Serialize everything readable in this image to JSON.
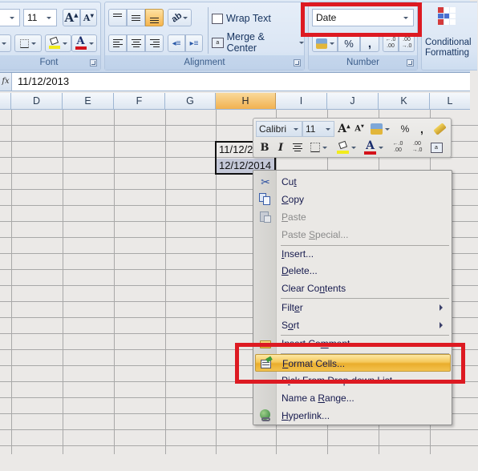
{
  "ribbon": {
    "font_group": {
      "label": "Font",
      "font_size": "11",
      "buttons": [
        "increase-font-size",
        "decrease-font-size",
        "borders",
        "fill-color",
        "font-color"
      ],
      "fill_color": "#f2ec1c",
      "font_color": "#d4121a"
    },
    "alignment_group": {
      "label": "Alignment",
      "wrap_text_label": "Wrap Text",
      "merge_center_label": "Merge & Center",
      "active_vertical_align": "bottom"
    },
    "number_group": {
      "label": "Number",
      "format_value": "Date",
      "percent_label": "%",
      "comma_label": ",",
      "increase_decimal_label": ".00",
      "decrease_decimal_label": ".0"
    },
    "styles_group": {
      "conditional_formatting_label_line1": "Conditional",
      "conditional_formatting_label_line2": "Formatting"
    }
  },
  "formula_bar": {
    "fx_label": "fx",
    "value": "11/12/2013"
  },
  "sheet": {
    "columns": [
      "D",
      "E",
      "F",
      "G",
      "H",
      "I",
      "J",
      "K",
      "L"
    ],
    "selected_column": "H",
    "cells": [
      {
        "ref": "H3",
        "value": "11/12/2013"
      },
      {
        "ref": "H4",
        "value": "12/12/2014"
      }
    ]
  },
  "mini_toolbar": {
    "font_name": "Calibri",
    "font_size": "11",
    "percent_label": "%",
    "comma_label": ",",
    "bold_label": "B",
    "italic_label": "I"
  },
  "context_menu": {
    "items": [
      {
        "label": "Cut",
        "underline_index": 2,
        "icon": "scissors-icon",
        "enabled": true
      },
      {
        "label": "Copy",
        "underline_index": 0,
        "icon": "copy-icon",
        "enabled": true
      },
      {
        "label": "Paste",
        "underline_index": 0,
        "icon": "paste-icon",
        "enabled": false
      },
      {
        "label": "Paste Special...",
        "underline_index": 6,
        "enabled": false
      },
      {
        "label": "Insert...",
        "underline_index": 0,
        "enabled": true
      },
      {
        "label": "Delete...",
        "underline_index": 0,
        "enabled": true
      },
      {
        "label": "Clear Contents",
        "underline_index": 8,
        "enabled": true
      },
      {
        "label": "Filter",
        "underline_index": 4,
        "enabled": true,
        "submenu": true
      },
      {
        "label": "Sort",
        "underline_index": 1,
        "enabled": true,
        "submenu": true
      },
      {
        "label": "Insert Comment",
        "underline_index": 9,
        "icon": "insert-comment-icon",
        "enabled": true
      },
      {
        "label": "Format Cells...",
        "underline_index": 0,
        "icon": "format-cells-icon",
        "enabled": true,
        "highlighted": true
      },
      {
        "label": "Pick From Drop-down List...",
        "underline_index": 1,
        "enabled": true
      },
      {
        "label": "Name a Range...",
        "underline_index": 7,
        "enabled": true
      },
      {
        "label": "Hyperlink...",
        "underline_index": 0,
        "icon": "hyperlink-icon",
        "enabled": true
      }
    ]
  },
  "annotations": {
    "highlight_color": "#dd1a22",
    "boxes": [
      "number-format-box",
      "format-cells-box"
    ]
  }
}
